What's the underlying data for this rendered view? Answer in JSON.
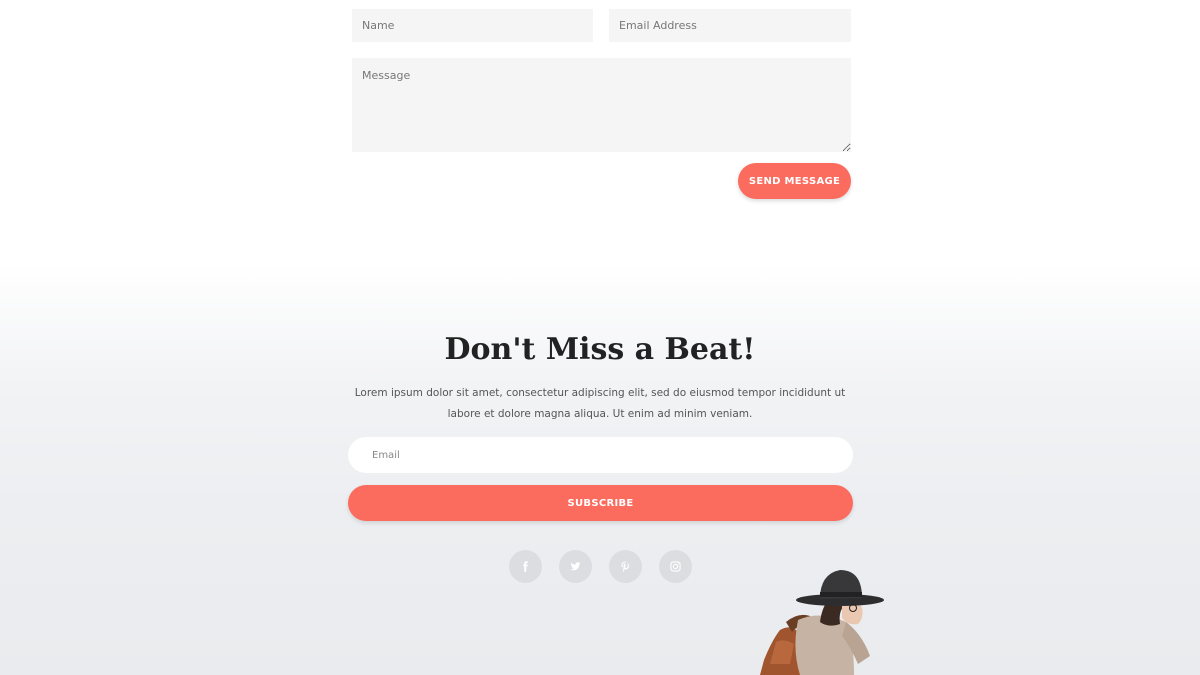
{
  "contact_form": {
    "name_placeholder": "Name",
    "email_placeholder": "Email Address",
    "message_placeholder": "Message",
    "send_label": "SEND MESSAGE"
  },
  "newsletter": {
    "headline": "Don't Miss a Beat!",
    "blurb": "Lorem ipsum dolor sit amet, consectetur adipiscing elit, sed do eiusmod tempor incididunt ut labore et dolore magna aliqua. Ut enim ad minim veniam.",
    "email_placeholder": "Email",
    "subscribe_label": "SUBSCRIBE"
  },
  "social": [
    {
      "icon": "facebook-icon"
    },
    {
      "icon": "twitter-icon"
    },
    {
      "icon": "pinterest-icon"
    },
    {
      "icon": "instagram-icon"
    }
  ],
  "colors": {
    "accent": "#fb6b5e",
    "field_bg": "#f5f5f6",
    "social_bg": "#dcdde0",
    "heading": "#222222"
  }
}
